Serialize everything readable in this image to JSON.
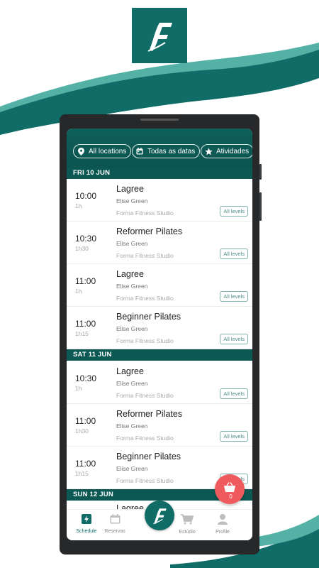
{
  "filters": [
    {
      "label": "All locations",
      "icon": "location-pin-icon"
    },
    {
      "label": "Todas as datas",
      "icon": "calendar-icon"
    },
    {
      "label": "Atividades",
      "icon": "star-icon"
    }
  ],
  "days": [
    {
      "label": "FRI 10 JUN",
      "classes": [
        {
          "time": "10:00",
          "duration": "1h",
          "name": "Lagree",
          "trainer": "Elise Green",
          "studio": "Forma Fitness Studio",
          "level": "All levels"
        },
        {
          "time": "10:30",
          "duration": "1h30",
          "name": "Reformer Pilates",
          "trainer": "Elise Green",
          "studio": "Forma Fitness Studio",
          "level": "All levels"
        },
        {
          "time": "11:00",
          "duration": "1h",
          "name": "Lagree",
          "trainer": "Elise Green",
          "studio": "Forma Fitness Studio",
          "level": "All levels"
        },
        {
          "time": "11:00",
          "duration": "1h15",
          "name": "Beginner Pilates",
          "trainer": "Elise Green",
          "studio": "Forma Fitness Studio",
          "level": "All levels"
        }
      ]
    },
    {
      "label": "SAT 11 JUN",
      "classes": [
        {
          "time": "10:30",
          "duration": "1h",
          "name": "Lagree",
          "trainer": "Elise Green",
          "studio": "Forma Fitness Studio",
          "level": "All levels"
        },
        {
          "time": "11:00",
          "duration": "1h30",
          "name": "Reformer Pilates",
          "trainer": "Elise Green",
          "studio": "Forma Fitness Studio",
          "level": "All levels"
        },
        {
          "time": "11:00",
          "duration": "1h15",
          "name": "Beginner Pilates",
          "trainer": "Elise Green",
          "studio": "Forma Fitness Studio",
          "level": "All levels"
        }
      ]
    },
    {
      "label": "SUN 12 JUN",
      "classes": [
        {
          "time": "",
          "duration": "",
          "name": "Lagree",
          "trainer": "",
          "studio": "",
          "level": ""
        }
      ]
    }
  ],
  "cart": {
    "count": "0",
    "icon": "basket-icon"
  },
  "nav": [
    {
      "label": "Schedule",
      "icon": "lightning-icon",
      "active": true
    },
    {
      "label": "Reservas",
      "icon": "calendar-icon",
      "active": false
    },
    {
      "label": "",
      "icon": "logo-icon",
      "active": false
    },
    {
      "label": "Estúdio",
      "icon": "cart-icon",
      "active": false
    },
    {
      "label": "Profile",
      "icon": "person-icon",
      "active": false
    }
  ],
  "colors": {
    "primary": "#0f6c67",
    "accent": "#ee5a5d",
    "wave_light": "#54b1a6"
  }
}
